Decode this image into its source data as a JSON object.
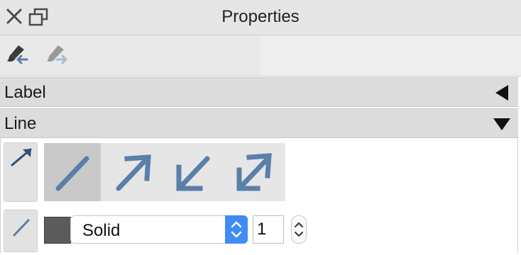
{
  "window": {
    "title": "Properties"
  },
  "sections": {
    "label": {
      "title": "Label"
    },
    "line": {
      "title": "Line"
    }
  },
  "line": {
    "style_value": "Solid",
    "width_value": "1"
  },
  "icons": {
    "close": "close-icon",
    "detach": "detach-window-icon",
    "paint_receive": "paintbrush-arrow-in-icon",
    "paint_send": "paintbrush-arrow-out-icon",
    "collapsed": "triangle-left-icon",
    "expanded": "triangle-down-icon"
  },
  "colors": {
    "line_color": "#5b5b5b",
    "icon_blue": "#5a7fa8",
    "select_accent": "#3f8cf5"
  }
}
